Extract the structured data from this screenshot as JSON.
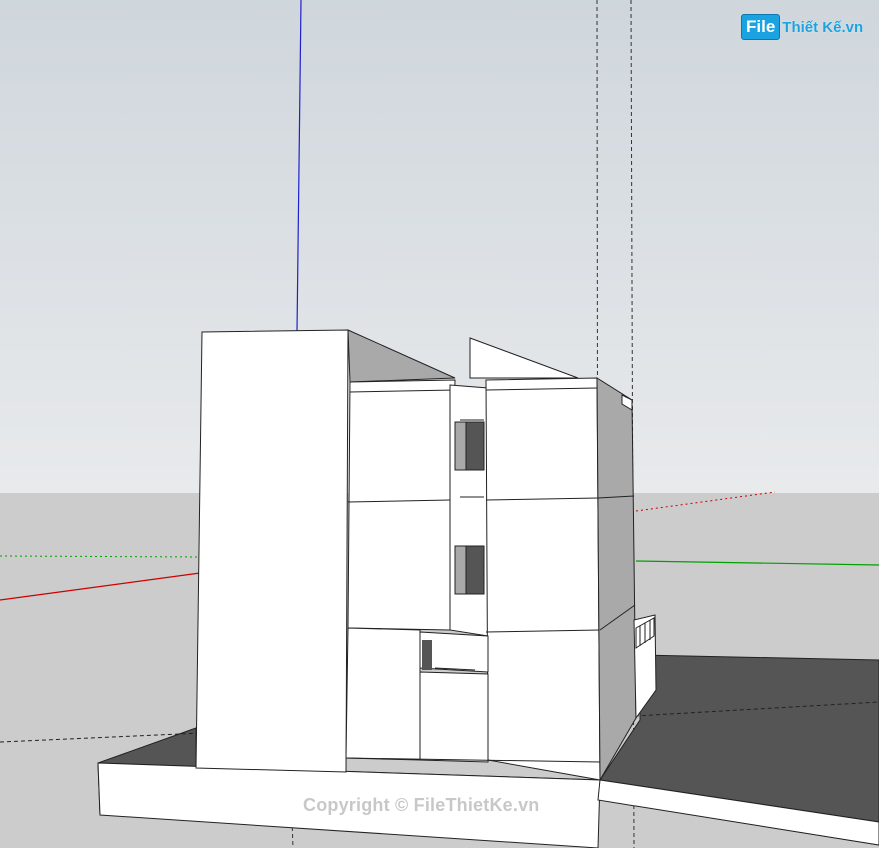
{
  "watermark": {
    "logo_box": "File",
    "logo_text": "Thiết Kế.vn",
    "copyright": "Copyright © FileThietKe.vn"
  },
  "colors": {
    "sky_top": "#cfd6dc",
    "sky_bottom": "#e9ecef",
    "ground": "#cccccc",
    "axis_red": "#cc0000",
    "axis_green": "#00a000",
    "axis_blue": "#0000cc",
    "face_white": "#ffffff",
    "face_gray": "#a9a9a9",
    "face_dark": "#555555"
  },
  "icons": {
    "logo": "filethietke-logo"
  }
}
